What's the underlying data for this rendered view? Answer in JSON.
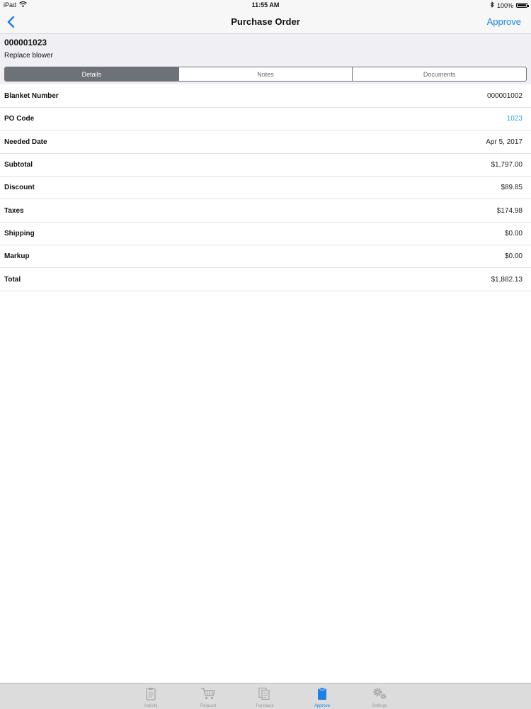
{
  "status_bar": {
    "device": "iPad",
    "time": "11:55 AM",
    "battery": "100%",
    "battery_level": 1.0
  },
  "nav": {
    "title": "Purchase Order",
    "approve_label": "Approve",
    "back_icon": "chevron-left-icon"
  },
  "header": {
    "po_number": "000001023",
    "description": "Replace blower"
  },
  "segments": [
    {
      "label": "Details",
      "active": true
    },
    {
      "label": "Notes",
      "active": false
    },
    {
      "label": "Documents",
      "active": false
    }
  ],
  "details": [
    {
      "label": "Blanket Number",
      "value": "000001002"
    },
    {
      "label": "PO Code",
      "value": "1023"
    },
    {
      "label": "Needed Date",
      "value": "Apr 5, 2017"
    },
    {
      "label": "Subtotal",
      "value": "$1,797.00"
    },
    {
      "label": "Discount",
      "value": "$89.85"
    },
    {
      "label": "Taxes",
      "value": "$174.98"
    },
    {
      "label": "Shipping",
      "value": "$0.00"
    },
    {
      "label": "Markup",
      "value": "$0.00"
    },
    {
      "label": "Total",
      "value": "$1,882.13"
    }
  ],
  "tabs": [
    {
      "label": "Activity",
      "icon": "clipboard-list-icon",
      "active": false
    },
    {
      "label": "Request",
      "icon": "cart-icon",
      "active": false
    },
    {
      "label": "Purchase",
      "icon": "documents-icon",
      "active": false
    },
    {
      "label": "Approve",
      "icon": "clipboard-icon",
      "active": true
    },
    {
      "label": "Settings",
      "icon": "gears-icon",
      "active": false
    }
  ],
  "colors": {
    "accent": "#1a82e2",
    "link": "#2aa7e0",
    "segment_active": "#6d7178",
    "header_bg": "#efeff4",
    "tab_bar_bg": "#dcdcdc"
  }
}
